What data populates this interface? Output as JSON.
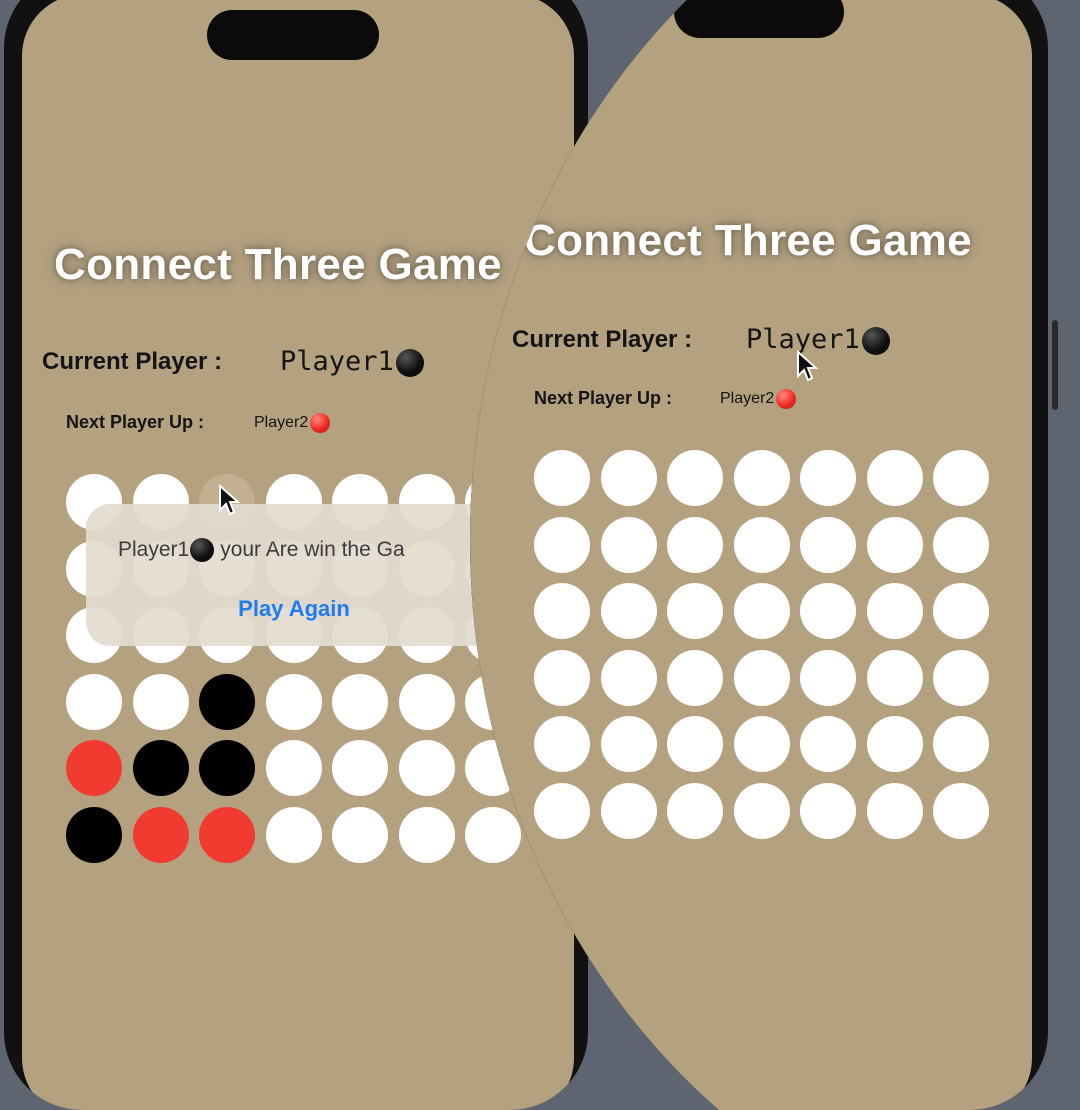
{
  "app": {
    "title": "Connect Three Game",
    "current_player_label": "Current Player :",
    "current_player_value": "Player1",
    "next_player_label": "Next Player Up :",
    "next_player_value": "Player2"
  },
  "alert": {
    "message_prefix": "Player1",
    "message_suffix": "your Are win the Ga",
    "button_label": "Play Again"
  },
  "boards": {
    "left": {
      "rows": [
        [
          "empty",
          "empty",
          "hover",
          "empty",
          "empty",
          "empty",
          "empty"
        ],
        [
          "empty",
          "empty",
          "empty",
          "empty",
          "empty",
          "empty",
          "empty"
        ],
        [
          "empty",
          "empty",
          "empty",
          "empty",
          "empty",
          "empty",
          "empty"
        ],
        [
          "empty",
          "empty",
          "black",
          "empty",
          "empty",
          "empty",
          "empty"
        ],
        [
          "red",
          "black",
          "black",
          "empty",
          "empty",
          "empty",
          "empty"
        ],
        [
          "black",
          "red",
          "red",
          "empty",
          "empty",
          "empty",
          "empty"
        ]
      ]
    },
    "right": {
      "rows": [
        [
          "empty",
          "empty",
          "empty",
          "empty",
          "empty",
          "empty",
          "empty"
        ],
        [
          "empty",
          "empty",
          "empty",
          "empty",
          "empty",
          "empty",
          "empty"
        ],
        [
          "empty",
          "empty",
          "empty",
          "empty",
          "empty",
          "empty",
          "empty"
        ],
        [
          "empty",
          "empty",
          "empty",
          "empty",
          "empty",
          "empty",
          "empty"
        ],
        [
          "empty",
          "empty",
          "empty",
          "empty",
          "empty",
          "empty",
          "empty"
        ],
        [
          "empty",
          "empty",
          "empty",
          "empty",
          "empty",
          "empty",
          "empty"
        ]
      ]
    }
  },
  "colors": {
    "screen_bg": "#b3a180",
    "player1_coin": "#000000",
    "player2_coin": "#f23b30",
    "empty_cell": "#ffffff",
    "button_text": "#1e7cf2"
  }
}
